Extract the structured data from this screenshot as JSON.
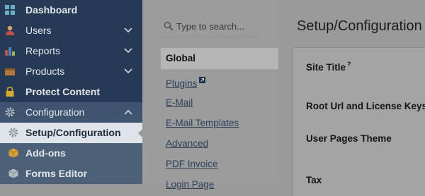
{
  "sidebar": {
    "items": [
      {
        "label": "Dashboard",
        "icon": "dashboard-icon"
      },
      {
        "label": "Users",
        "icon": "users-icon"
      },
      {
        "label": "Reports",
        "icon": "reports-icon"
      },
      {
        "label": "Products",
        "icon": "products-icon"
      },
      {
        "label": "Protect Content",
        "icon": "lock-icon"
      },
      {
        "label": "Configuration",
        "icon": "gear-icon"
      },
      {
        "label": "Setup/Configuration",
        "icon": "gear-icon"
      },
      {
        "label": "Add-ons",
        "icon": "box-icon"
      },
      {
        "label": "Forms Editor",
        "icon": "cube-icon"
      }
    ]
  },
  "tabs": {
    "search_placeholder": "Type to search...",
    "active": "Global",
    "links": [
      "Plugins",
      "E-Mail",
      "E-Mail Templates",
      "Advanced",
      "PDF Invoice",
      "Login Page"
    ]
  },
  "main": {
    "title": "Setup/Configuration :",
    "fields": [
      {
        "label": "Site Title",
        "help": "?"
      },
      {
        "label": "Root Url and License Keys"
      },
      {
        "label": "User Pages Theme"
      },
      {
        "label": "Tax"
      }
    ]
  },
  "colors": {
    "sidebar_bg": "#263a55",
    "active_item_bg": "#dee4ea",
    "link": "#2d3f58"
  }
}
